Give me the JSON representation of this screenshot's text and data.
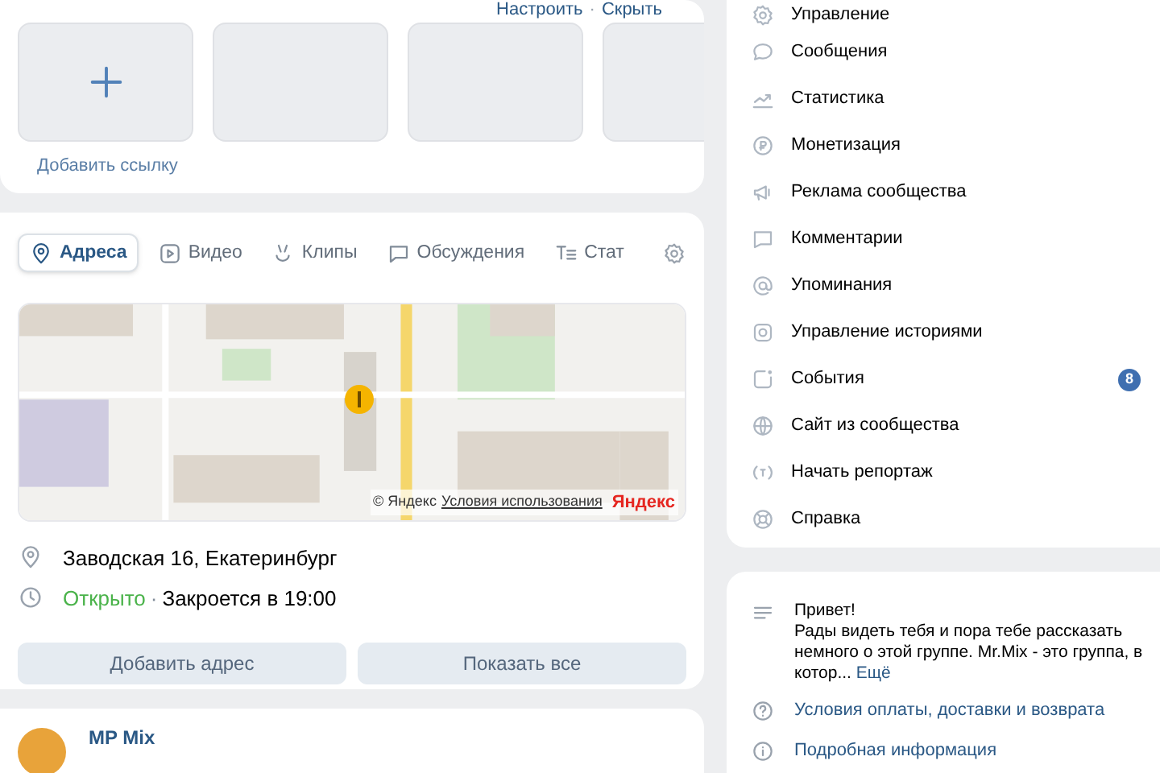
{
  "links_block": {
    "actions": [
      "Настроить",
      "Скрыть"
    ],
    "separator": "·",
    "add_link": "Добавить ссылку",
    "tiles": [
      {
        "kind": "add"
      },
      {
        "kind": "empty"
      },
      {
        "kind": "empty"
      },
      {
        "kind": "empty"
      }
    ]
  },
  "addresses_block": {
    "tabs": [
      {
        "label": "Адреса",
        "selected": true
      },
      {
        "label": "Видео",
        "selected": false
      },
      {
        "label": "Клипы",
        "selected": false
      },
      {
        "label": "Обсуждения",
        "selected": false
      },
      {
        "label": "Стат",
        "selected": false
      }
    ],
    "map": {
      "kind": "picture",
      "copyright": "© Яндекс",
      "terms": "Условия использования",
      "logo": "Яндекс"
    },
    "address": "Заводская 16, Екатеринбург",
    "hours": {
      "status": "Открыто",
      "separator": "·",
      "closes": "Закроется в 19:00"
    },
    "buttons": [
      "Добавить адрес",
      "Показать все"
    ]
  },
  "post": {
    "author": "MP Mix"
  },
  "menu": [
    {
      "label": "Управление"
    },
    {
      "label": "Сообщения"
    },
    {
      "label": "Статистика"
    },
    {
      "label": "Монетизация"
    },
    {
      "label": "Реклама сообщества"
    },
    {
      "label": "Комментарии"
    },
    {
      "label": "Упоминания"
    },
    {
      "label": "Управление историями"
    },
    {
      "label": "События",
      "badge": "8"
    },
    {
      "label": "Сайт из сообщества"
    },
    {
      "label": "Начать репортаж"
    },
    {
      "label": "Справка"
    }
  ],
  "info": {
    "greeting": "Привет!",
    "description": "Рады видеть тебя и пора тебе рассказать немного о этой группе. Mr.Mix - это группа, в котор...",
    "more": "Ещё",
    "links": [
      "Условия оплаты, доставки и возврата",
      "Подробная информация"
    ]
  }
}
